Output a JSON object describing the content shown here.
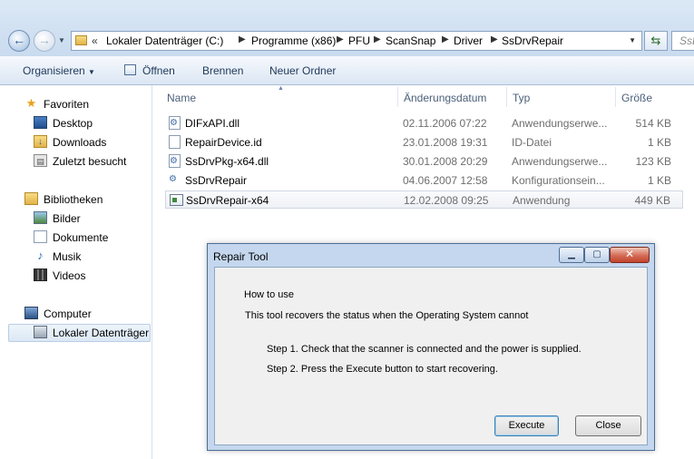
{
  "address": {
    "overflow": "«",
    "crumbs": [
      "Lokaler Datenträger (C:)",
      "Programme (x86)",
      "PFU",
      "ScanSnap",
      "Driver",
      "SsDrvRepair"
    ],
    "search_placeholder": "SsD"
  },
  "toolbar": {
    "organize": "Organisieren",
    "open": "Öffnen",
    "burn": "Brennen",
    "new_folder": "Neuer Ordner"
  },
  "nav": {
    "favorites": "Favoriten",
    "desktop": "Desktop",
    "downloads": "Downloads",
    "recent": "Zuletzt besucht",
    "libraries": "Bibliotheken",
    "pictures": "Bilder",
    "documents": "Dokumente",
    "music": "Musik",
    "videos": "Videos",
    "computer": "Computer",
    "local_disk": "Lokaler Datenträger"
  },
  "columns": {
    "name": "Name",
    "date": "Änderungsdatum",
    "type": "Typ",
    "size": "Größe"
  },
  "files": [
    {
      "name": "DIFxAPI.dll",
      "date": "02.11.2006 07:22",
      "type": "Anwendungserwe...",
      "size": "514 KB",
      "icon": "dll-gear-icon"
    },
    {
      "name": "RepairDevice.id",
      "date": "23.01.2008 19:31",
      "type": "ID-Datei",
      "size": "1 KB",
      "icon": "file-icon"
    },
    {
      "name": "SsDrvPkg-x64.dll",
      "date": "30.01.2008 20:29",
      "type": "Anwendungserwe...",
      "size": "123 KB",
      "icon": "dll-gear-icon"
    },
    {
      "name": "SsDrvRepair",
      "date": "04.06.2007 12:58",
      "type": "Konfigurationsein...",
      "size": "1 KB",
      "icon": "config-gear-icon"
    },
    {
      "name": "SsDrvRepair-x64",
      "date": "12.02.2008 09:25",
      "type": "Anwendung",
      "size": "449 KB",
      "icon": "application-icon"
    }
  ],
  "dialog": {
    "title": "Repair Tool",
    "how_to_use": "How to use",
    "description": "This tool recovers the status when the Operating System cannot",
    "step1": "Step 1. Check that the scanner is connected and the power is supplied.",
    "step2": "Step 2. Press the Execute button to start recovering.",
    "execute": "Execute",
    "close": "Close"
  }
}
